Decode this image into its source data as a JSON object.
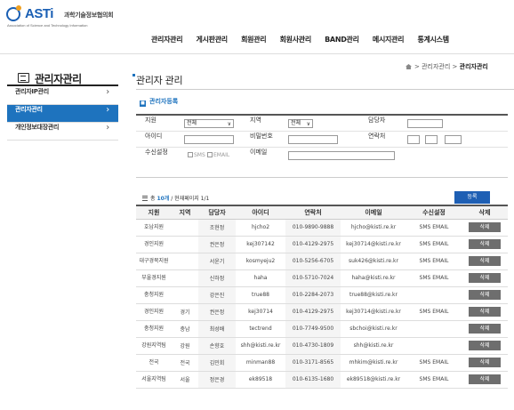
{
  "logo": {
    "name": "ASTi",
    "kor": "과학기술정보협의회",
    "eng": "Association of Science and Technology Information"
  },
  "gnb": [
    "관리자관리",
    "게시판관리",
    "회원관리",
    "회원사관리",
    "BAND관리",
    "메시지관리",
    "통계시스템"
  ],
  "sidebar": {
    "title": "관리자관리",
    "items": [
      {
        "label": "관리자IP관리",
        "active": false
      },
      {
        "label": "관리자관리",
        "active": true
      },
      {
        "label": "개인정보대장관리",
        "active": false
      }
    ]
  },
  "breadcrumb": {
    "sep": ">",
    "parent": "관리자관리",
    "current": "관리자관리"
  },
  "page_title": "관리자 관리",
  "section_title": "관리자등록",
  "form": {
    "branch_label": "지원",
    "branch_value": "전체",
    "region_label": "지역",
    "region_value": "전체",
    "manager_label": "담당자",
    "id_label": "아이디",
    "password_label": "비밀번호",
    "phone_label": "연락처",
    "receive_label": "수신설정",
    "sms_label": "SMS",
    "email_label": "EMAIL",
    "email_field_label": "이메일",
    "register_button": "등록"
  },
  "count": {
    "prefix": "총",
    "total": "10개",
    "page_info": "/ 현재페이지 1/1"
  },
  "table": {
    "headers": [
      "지원",
      "지역",
      "담당자",
      "아이디",
      "연락처",
      "이메일",
      "수신설정",
      "삭제"
    ],
    "delete_label": "삭제",
    "rows": [
      {
        "branch": "호남지원",
        "region": "",
        "manager": "조현정",
        "id": "hjcho2",
        "phone": "010-9890-9888",
        "email": "hjcho@kisti.re.kr",
        "receive": "SMS EMAIL"
      },
      {
        "branch": "경인지원",
        "region": "",
        "manager": "권은정",
        "id": "kej307142",
        "phone": "010-4129-2975",
        "email": "kej30714@kisti.re.kr",
        "receive": "SMS EMAIL"
      },
      {
        "branch": "대구경북지원",
        "region": "",
        "manager": "서윤기",
        "id": "kosmyeju2",
        "phone": "010-5256-6705",
        "email": "suk426@kisti.re.kr",
        "receive": "SMS EMAIL"
      },
      {
        "branch": "부울경지원",
        "region": "",
        "manager": "신하정",
        "id": "haha",
        "phone": "010-5710-7024",
        "email": "haha@kisti.re.kr",
        "receive": "SMS EMAIL"
      },
      {
        "branch": "충청지원",
        "region": "",
        "manager": "강은진",
        "id": "true88",
        "phone": "010-2284-2073",
        "email": "true88@kisti.re.kr",
        "receive": ""
      },
      {
        "branch": "경인지원",
        "region": "경기",
        "manager": "권은정",
        "id": "kej30714",
        "phone": "010-4129-2975",
        "email": "kej30714@kisti.re.kr",
        "receive": "SMS EMAIL"
      },
      {
        "branch": "충청지원",
        "region": "충남",
        "manager": "최성배",
        "id": "tectrend",
        "phone": "010-7749-9500",
        "email": "sbchoi@kisti.re.kr",
        "receive": ""
      },
      {
        "branch": "강원지역팀",
        "region": "강원",
        "manager": "손향호",
        "id": "shh@kisti.re.kr",
        "phone": "010-4730-1809",
        "email": "shh@kisti.re.kr",
        "receive": ""
      },
      {
        "branch": "전국",
        "region": "전국",
        "manager": "김민회",
        "id": "minman88",
        "phone": "010-3171-8565",
        "email": "mhkim@kisti.re.kr",
        "receive": "SMS EMAIL"
      },
      {
        "branch": "서울지역팀",
        "region": "서울",
        "manager": "정은경",
        "id": "ek89518",
        "phone": "010-6135-1680",
        "email": "ek89518@kisti.re.kr",
        "receive": "SMS EMAIL"
      }
    ]
  },
  "colors": {
    "accent": "#1e73be",
    "button_dark": "#6e6e6e"
  }
}
